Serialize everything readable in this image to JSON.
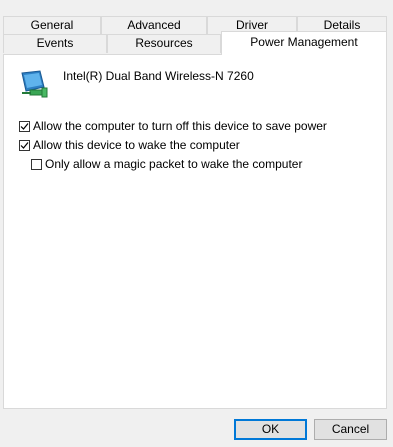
{
  "tabs": {
    "row1": [
      "General",
      "Advanced",
      "Driver",
      "Details"
    ],
    "row2": [
      "Events",
      "Resources"
    ],
    "active": "Power Management"
  },
  "device": {
    "name": "Intel(R) Dual Band Wireless-N 7260",
    "icon": "network-adapter-icon"
  },
  "options": [
    {
      "label": "Allow the computer to turn off this device to save power",
      "checked": true
    },
    {
      "label": "Allow this device to wake the computer",
      "checked": true
    },
    {
      "label": "Only allow a magic packet to wake the computer",
      "checked": false
    }
  ],
  "buttons": {
    "ok": "OK",
    "cancel": "Cancel"
  },
  "colors": {
    "accent": "#0078d7",
    "window_bg": "#f0f0f0",
    "panel_bg": "#ffffff"
  }
}
